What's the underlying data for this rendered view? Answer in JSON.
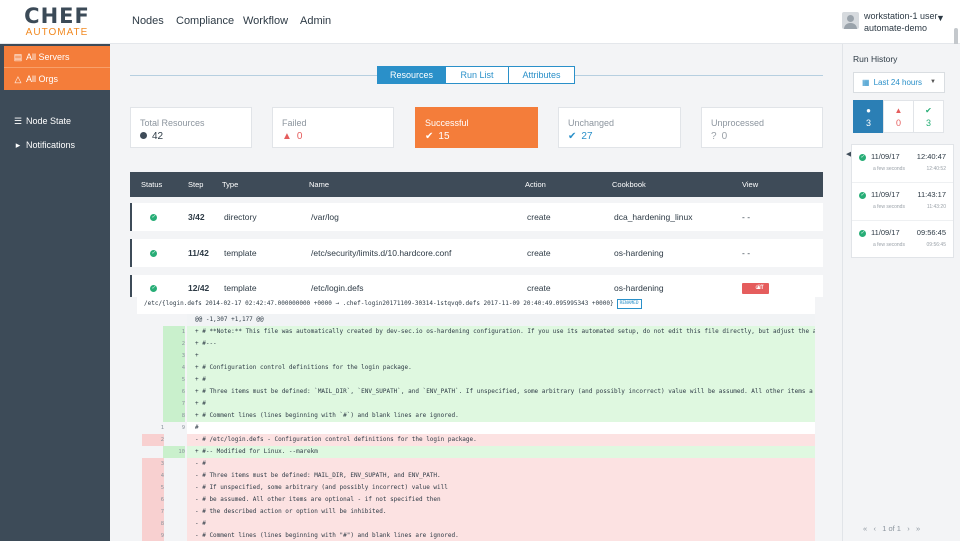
{
  "brand": {
    "line1": "CHEF",
    "line2": "AUTOMATE"
  },
  "nav": [
    "Nodes",
    "Compliance",
    "Workflow",
    "Admin"
  ],
  "user": {
    "name": "workstation-1 user",
    "org": "automate-demo"
  },
  "sidebar": {
    "top": [
      {
        "label": "All Servers",
        "icon": "server-icon"
      },
      {
        "label": "All Orgs",
        "icon": "orgs-icon"
      }
    ],
    "items": [
      {
        "label": "Node State",
        "icon": "list-icon"
      },
      {
        "label": "Notifications",
        "icon": "megaphone-icon"
      }
    ]
  },
  "tabs": [
    "Resources",
    "Run List",
    "Attributes"
  ],
  "cards": [
    {
      "title": "Total Resources",
      "value": "42"
    },
    {
      "title": "Failed",
      "value": "0"
    },
    {
      "title": "Successful",
      "value": "15"
    },
    {
      "title": "Unchanged",
      "value": "27"
    },
    {
      "title": "Unprocessed",
      "value": "0"
    }
  ],
  "table": {
    "headers": [
      "Status",
      "Step",
      "Type",
      "Name",
      "Action",
      "Cookbook",
      "View"
    ],
    "rows": [
      {
        "step": "3/42",
        "type": "directory",
        "name": "/var/log",
        "action": "create",
        "cookbook": "dca_hardening_linux",
        "view": "- -"
      },
      {
        "step": "11/42",
        "type": "template",
        "name": "/etc/security/limits.d/10.hardcore.conf",
        "action": "create",
        "cookbook": "os-hardening",
        "view": "- -"
      },
      {
        "step": "12/42",
        "type": "template",
        "name": "/etc/login.defs",
        "action": "create",
        "cookbook": "os-hardening",
        "view": "diff"
      }
    ]
  },
  "diff": {
    "header": "/etc/{login.defs 2014-02-17 02:42:47.000000000 +0000 → .chef-login20171109-30314-1stqvq0.defs 2017-11-09 20:40:49.095995343 +0000}",
    "badge": "RENAMED",
    "lines": [
      {
        "t": "hunk",
        "n1": "",
        "n2": "",
        "text": "@@ -1,307 +1,177 @@"
      },
      {
        "t": "add",
        "n1": "",
        "n2": "1",
        "text": "+ # **Note:** This file was automatically created by dev-sec.io os-hardening configuration. If you use its automated setup, do not edit this file directly, but adjust the au"
      },
      {
        "t": "add",
        "n1": "",
        "n2": "2",
        "text": "+ #---"
      },
      {
        "t": "add",
        "n1": "",
        "n2": "3",
        "text": "+"
      },
      {
        "t": "add",
        "n1": "",
        "n2": "4",
        "text": "+ # Configuration control definitions for the login package."
      },
      {
        "t": "add",
        "n1": "",
        "n2": "5",
        "text": "+ #"
      },
      {
        "t": "add",
        "n1": "",
        "n2": "6",
        "text": "+ # Three items must be defined:  `MAIL_DIR`, `ENV_SUPATH`, and `ENV_PATH`. If unspecified, some arbitrary (and possibly incorrect) value will be assumed.  All other items a"
      },
      {
        "t": "add",
        "n1": "",
        "n2": "7",
        "text": "+ #"
      },
      {
        "t": "add",
        "n1": "",
        "n2": "8",
        "text": "+ # Comment lines (lines beginning with `#`) and blank lines are ignored."
      },
      {
        "t": "ctx",
        "n1": "1",
        "n2": "9",
        "text": "  #"
      },
      {
        "t": "del",
        "n1": "2",
        "n2": "",
        "text": "- # /etc/login.defs - Configuration control definitions for the login package."
      },
      {
        "t": "add",
        "n1": "",
        "n2": "10",
        "text": "+ #-- Modified for Linux.  --marekm"
      },
      {
        "t": "del",
        "n1": "3",
        "n2": "",
        "text": "- #"
      },
      {
        "t": "del",
        "n1": "4",
        "n2": "",
        "text": "- # Three items must be defined:  MAIL_DIR, ENV_SUPATH, and ENV_PATH."
      },
      {
        "t": "del",
        "n1": "5",
        "n2": "",
        "text": "- # If unspecified, some arbitrary (and possibly incorrect) value will"
      },
      {
        "t": "del",
        "n1": "6",
        "n2": "",
        "text": "- # be assumed.  All other items are optional - if not specified then"
      },
      {
        "t": "del",
        "n1": "7",
        "n2": "",
        "text": "- # the described action or option will be inhibited."
      },
      {
        "t": "del",
        "n1": "8",
        "n2": "",
        "text": "- #"
      },
      {
        "t": "del",
        "n1": "9",
        "n2": "",
        "text": "- # Comment lines (lines beginning with \"#\") and blank lines are ignored."
      }
    ]
  },
  "run_history": {
    "title": "Run History",
    "select": "Last 24 hours",
    "stats": [
      "3",
      "0",
      "3"
    ],
    "runs": [
      {
        "date": "11/09/17",
        "time": "12:40:47",
        "ago": "a few seconds",
        "time2": "12:40:52"
      },
      {
        "date": "11/09/17",
        "time": "11:43:17",
        "ago": "a few seconds",
        "time2": "11:43:20"
      },
      {
        "date": "11/09/17",
        "time": "09:56:45",
        "ago": "a few seconds",
        "time2": "09:56:45"
      }
    ],
    "pager": "1 of 1"
  },
  "colors": {
    "accent": "#f47d3a",
    "primary": "#2a90c9",
    "sidebar": "#3d4b58",
    "success": "#27ad76",
    "danger": "#e55d5d"
  }
}
